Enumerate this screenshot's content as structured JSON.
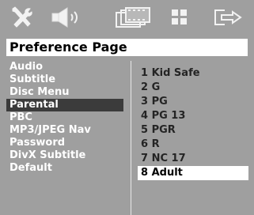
{
  "toolbar": {
    "icons": [
      "tools-icon",
      "speaker-icon",
      "film-icon",
      "grid-icon",
      "exit-icon"
    ]
  },
  "header": {
    "title": "Preference Page"
  },
  "left_menu": {
    "items": [
      {
        "label": "Audio"
      },
      {
        "label": "Subtitle"
      },
      {
        "label": "Disc Menu"
      },
      {
        "label": "Parental"
      },
      {
        "label": "PBC"
      },
      {
        "label": "MP3/JPEG Nav"
      },
      {
        "label": "Password"
      },
      {
        "label": "DivX Subtitle"
      },
      {
        "label": "Default"
      }
    ],
    "active": "Parental"
  },
  "options": {
    "items": [
      {
        "label": "1 Kid Safe"
      },
      {
        "label": "2 G"
      },
      {
        "label": "3 PG"
      },
      {
        "label": "4 PG 13"
      },
      {
        "label": "5 PGR"
      },
      {
        "label": "6 R"
      },
      {
        "label": "7 NC 17"
      },
      {
        "label": "8 Adult"
      }
    ],
    "selected": "8 Adult"
  },
  "colors": {
    "background": "#9f9f9f",
    "title_bg": "#ffffff",
    "active_menu_bg": "#3b3b3b",
    "menu_text": "#ffffff",
    "option_text": "#242424",
    "selected_bg": "#ffffff"
  }
}
